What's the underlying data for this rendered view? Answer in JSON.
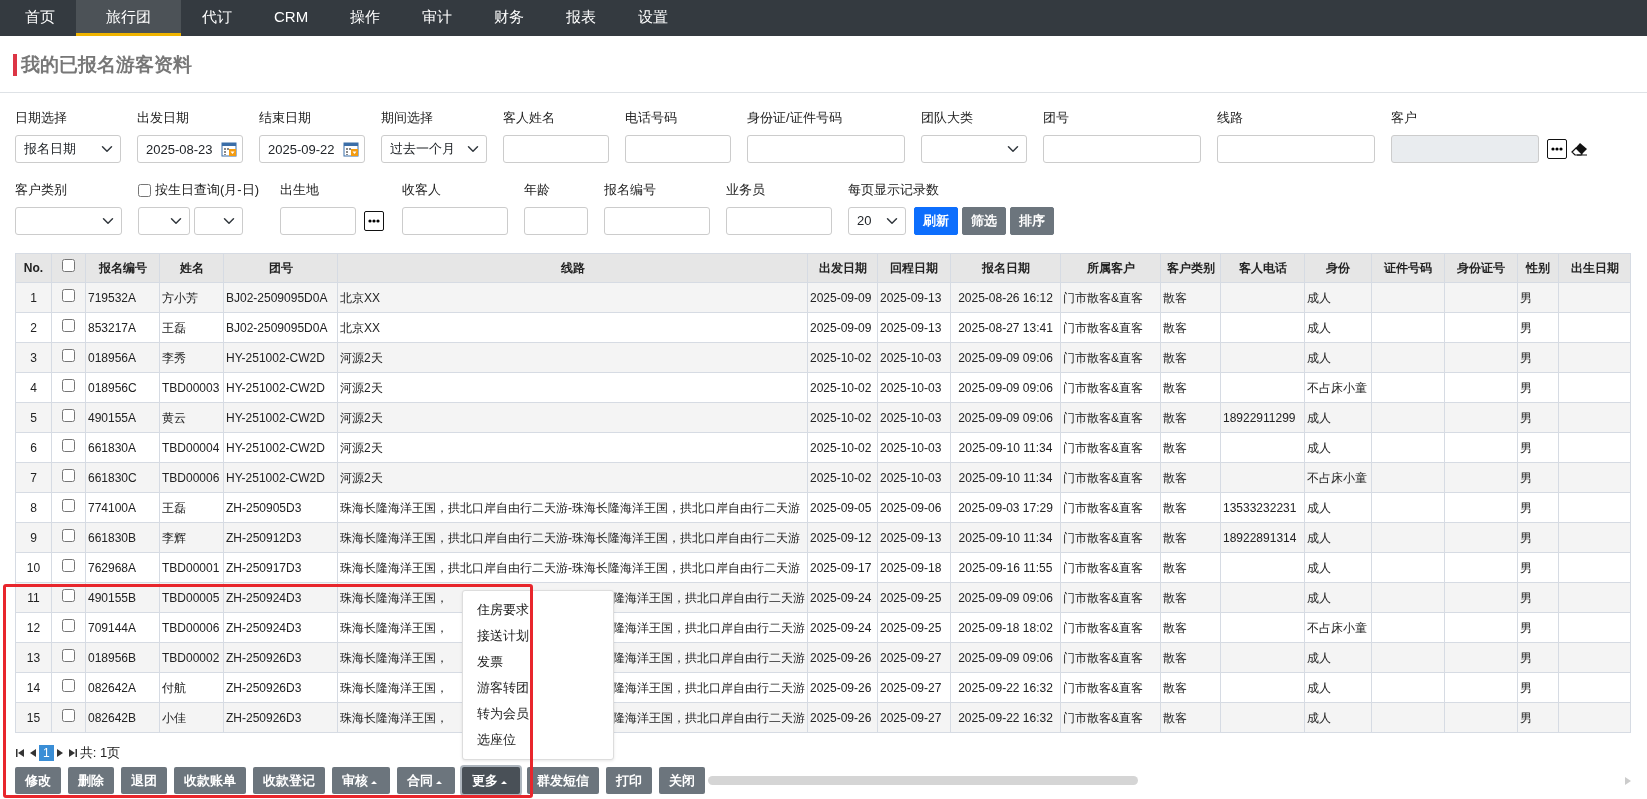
{
  "nav_tabs": [
    {
      "label": "首页",
      "selected": false
    },
    {
      "label": "旅行团",
      "selected": true
    },
    {
      "label": "代订",
      "selected": false
    },
    {
      "label": "CRM",
      "selected": false
    },
    {
      "label": "操作",
      "selected": false
    },
    {
      "label": "审计",
      "selected": false
    },
    {
      "label": "财务",
      "selected": false
    },
    {
      "label": "报表",
      "selected": false
    },
    {
      "label": "设置",
      "selected": false
    }
  ],
  "page_title": "我的已报名游客资料",
  "filter_rows": [
    [
      {
        "kind": "select",
        "label": "日期选择",
        "value": "报名日期"
      },
      {
        "kind": "date",
        "label": "出发日期",
        "value": "2025-08-23"
      },
      {
        "kind": "date",
        "label": "结束日期",
        "value": "2025-09-22"
      },
      {
        "kind": "select",
        "label": "期间选择",
        "value": "过去一个月"
      },
      {
        "kind": "text",
        "label": "客人姓名"
      },
      {
        "kind": "text",
        "label": "电话号码"
      },
      {
        "kind": "text",
        "label": "身份证/证件号码"
      },
      {
        "kind": "select",
        "label": "团队大类"
      },
      {
        "kind": "text",
        "label": "团号"
      },
      {
        "kind": "text",
        "label": "线路"
      },
      {
        "kind": "picker",
        "label": "客户",
        "disabled": true,
        "clearable": true
      }
    ],
    [
      {
        "kind": "select",
        "label": "客户类别"
      },
      {
        "kind": "birthday",
        "label": "按生日查询(月-日)",
        "checked": false
      },
      {
        "kind": "picker",
        "label": "出生地",
        "disabled": false,
        "clearable": false
      },
      {
        "kind": "text",
        "label": "收客人"
      },
      {
        "kind": "text",
        "label": "年龄"
      },
      {
        "kind": "text",
        "label": "报名编号"
      },
      {
        "kind": "text",
        "label": "业务员"
      },
      {
        "kind": "page-size",
        "label": "每页显示记录数",
        "value": "20",
        "buttons": [
          {
            "label": "刷新"
          },
          {
            "label": "筛选"
          },
          {
            "label": "排序"
          }
        ]
      }
    ]
  ],
  "table": {
    "header_checked": false,
    "columns": [
      {
        "label": "No."
      },
      {
        "kind": "checkbox"
      },
      {
        "label": "报名编号"
      },
      {
        "label": "姓名"
      },
      {
        "label": "团号"
      },
      {
        "label": "线路"
      },
      {
        "label": "出发日期"
      },
      {
        "label": "回程日期"
      },
      {
        "label": "报名日期"
      },
      {
        "label": "所属客户"
      },
      {
        "label": "客户类别"
      },
      {
        "label": "客人电话"
      },
      {
        "label": "身份"
      },
      {
        "label": "证件号码"
      },
      {
        "label": "身份证号"
      },
      {
        "label": "性别"
      },
      {
        "label": "出生日期"
      }
    ],
    "rows": [
      {
        "no": "1",
        "checked": false,
        "reg_no": "719532A",
        "name": "方小芳",
        "group_no": "BJ02-2509095D0A",
        "route": "北京XX",
        "depart": "2025-09-09",
        "return": "2025-09-13",
        "reg_date": "2025-08-26 16:12",
        "customer": "门市散客&直客",
        "cust_type": "散客",
        "identity": "成人",
        "gender": "男"
      },
      {
        "no": "2",
        "checked": false,
        "reg_no": "853217A",
        "name": "王磊",
        "group_no": "BJ02-2509095D0A",
        "route": "北京XX",
        "depart": "2025-09-09",
        "return": "2025-09-13",
        "reg_date": "2025-08-27 13:41",
        "customer": "门市散客&直客",
        "cust_type": "散客",
        "identity": "成人",
        "gender": "男"
      },
      {
        "no": "3",
        "checked": false,
        "reg_no": "018956A",
        "name": "李秀",
        "group_no": "HY-251002-CW2D",
        "route": "河源2天",
        "depart": "2025-10-02",
        "return": "2025-10-03",
        "reg_date": "2025-09-09 09:06",
        "customer": "门市散客&直客",
        "cust_type": "散客",
        "identity": "成人",
        "gender": "男"
      },
      {
        "no": "4",
        "checked": false,
        "reg_no": "018956C",
        "name": "TBD00003",
        "group_no": "HY-251002-CW2D",
        "route": "河源2天",
        "depart": "2025-10-02",
        "return": "2025-10-03",
        "reg_date": "2025-09-09 09:06",
        "customer": "门市散客&直客",
        "cust_type": "散客",
        "identity": "不占床小童",
        "gender": "男"
      },
      {
        "no": "5",
        "checked": false,
        "reg_no": "490155A",
        "name": "黄云",
        "group_no": "HY-251002-CW2D",
        "route": "河源2天",
        "depart": "2025-10-02",
        "return": "2025-10-03",
        "reg_date": "2025-09-09 09:06",
        "customer": "门市散客&直客",
        "cust_type": "散客",
        "phone": "18922911299",
        "identity": "成人",
        "gender": "男"
      },
      {
        "no": "6",
        "checked": false,
        "reg_no": "661830A",
        "name": "TBD00004",
        "group_no": "HY-251002-CW2D",
        "route": "河源2天",
        "depart": "2025-10-02",
        "return": "2025-10-03",
        "reg_date": "2025-09-10 11:34",
        "customer": "门市散客&直客",
        "cust_type": "散客",
        "identity": "成人",
        "gender": "男"
      },
      {
        "no": "7",
        "checked": false,
        "reg_no": "661830C",
        "name": "TBD00006",
        "group_no": "HY-251002-CW2D",
        "route": "河源2天",
        "depart": "2025-10-02",
        "return": "2025-10-03",
        "reg_date": "2025-09-10 11:34",
        "customer": "门市散客&直客",
        "cust_type": "散客",
        "identity": "不占床小童",
        "gender": "男"
      },
      {
        "no": "8",
        "checked": false,
        "reg_no": "774100A",
        "name": "王磊",
        "group_no": "ZH-250905D3",
        "route": "珠海长隆海洋王国，拱北口岸自由行二天游-珠海长隆海洋王国，拱北口岸自由行二天游",
        "depart": "2025-09-05",
        "return": "2025-09-06",
        "reg_date": "2025-09-03 17:29",
        "customer": "门市散客&直客",
        "cust_type": "散客",
        "phone": "13533232231",
        "identity": "成人",
        "gender": "男"
      },
      {
        "no": "9",
        "checked": false,
        "reg_no": "661830B",
        "name": "李辉",
        "group_no": "ZH-250912D3",
        "route": "珠海长隆海洋王国，拱北口岸自由行二天游-珠海长隆海洋王国，拱北口岸自由行二天游",
        "depart": "2025-09-12",
        "return": "2025-09-13",
        "reg_date": "2025-09-10 11:34",
        "customer": "门市散客&直客",
        "cust_type": "散客",
        "phone": "18922891314",
        "identity": "成人",
        "gender": "男"
      },
      {
        "no": "10",
        "checked": false,
        "reg_no": "762968A",
        "name": "TBD00001",
        "group_no": "ZH-250917D3",
        "route": "珠海长隆海洋王国，拱北口岸自由行二天游-珠海长隆海洋王国，拱北口岸自由行二天游",
        "depart": "2025-09-17",
        "return": "2025-09-18",
        "reg_date": "2025-09-16 11:55",
        "customer": "门市散客&直客",
        "cust_type": "散客",
        "identity": "成人",
        "gender": "男"
      },
      {
        "no": "11",
        "checked": false,
        "reg_no": "490155B",
        "name": "TBD00005",
        "group_no": "ZH-250924D3",
        "route": "珠海长隆海洋王国，",
        "route_tail": "隆海洋王国，拱北口岸自由行二天游",
        "depart": "2025-09-24",
        "return": "2025-09-25",
        "reg_date": "2025-09-09 09:06",
        "customer": "门市散客&直客",
        "cust_type": "散客",
        "identity": "成人",
        "gender": "男"
      },
      {
        "no": "12",
        "checked": false,
        "reg_no": "709144A",
        "name": "TBD00006",
        "group_no": "ZH-250924D3",
        "route": "珠海长隆海洋王国，",
        "route_tail": "隆海洋王国，拱北口岸自由行二天游",
        "depart": "2025-09-24",
        "return": "2025-09-25",
        "reg_date": "2025-09-18 18:02",
        "customer": "门市散客&直客",
        "cust_type": "散客",
        "identity": "不占床小童",
        "gender": "男"
      },
      {
        "no": "13",
        "checked": false,
        "reg_no": "018956B",
        "name": "TBD00002",
        "group_no": "ZH-250926D3",
        "route": "珠海长隆海洋王国，",
        "route_tail": "隆海洋王国，拱北口岸自由行二天游",
        "depart": "2025-09-26",
        "return": "2025-09-27",
        "reg_date": "2025-09-09 09:06",
        "customer": "门市散客&直客",
        "cust_type": "散客",
        "identity": "成人",
        "gender": "男"
      },
      {
        "no": "14",
        "checked": false,
        "reg_no": "082642A",
        "name": "付航",
        "group_no": "ZH-250926D3",
        "route": "珠海长隆海洋王国，",
        "route_tail": "隆海洋王国，拱北口岸自由行二天游",
        "depart": "2025-09-26",
        "return": "2025-09-27",
        "reg_date": "2025-09-22 16:32",
        "customer": "门市散客&直客",
        "cust_type": "散客",
        "identity": "成人",
        "gender": "男"
      },
      {
        "no": "15",
        "checked": false,
        "reg_no": "082642B",
        "name": "小佳",
        "group_no": "ZH-250926D3",
        "route": "珠海长隆海洋王国，",
        "route_tail": "隆海洋王国，拱北口岸自由行二天游",
        "depart": "2025-09-26",
        "return": "2025-09-27",
        "reg_date": "2025-09-22 16:32",
        "customer": "门市散客&直客",
        "cust_type": "散客",
        "identity": "成人",
        "gender": "男"
      }
    ]
  },
  "pager": {
    "pages": [
      {
        "label": "1",
        "selected": true
      }
    ],
    "summary": "共: 1页"
  },
  "actions": [
    {
      "label": "修改",
      "caret": false,
      "expanded": false
    },
    {
      "label": "删除",
      "caret": false,
      "expanded": false
    },
    {
      "label": "退团",
      "caret": false,
      "expanded": false
    },
    {
      "label": "收款账单",
      "caret": false,
      "expanded": false
    },
    {
      "label": "收款登记",
      "caret": false,
      "expanded": false
    },
    {
      "label": "审核",
      "caret": true,
      "expanded": false
    },
    {
      "label": "合同",
      "caret": true,
      "expanded": false
    },
    {
      "label": "更多",
      "caret": true,
      "expanded": true,
      "menu": [
        "住房要求",
        "接送计划",
        "发票",
        "游客转团",
        "转为会员",
        "选座位"
      ]
    },
    {
      "label": "群发短信",
      "caret": false,
      "expanded": false
    },
    {
      "label": "打印",
      "caret": false,
      "expanded": false
    },
    {
      "label": "关闭",
      "caret": false,
      "expanded": false
    }
  ],
  "annotation": {
    "kind": "frame"
  }
}
